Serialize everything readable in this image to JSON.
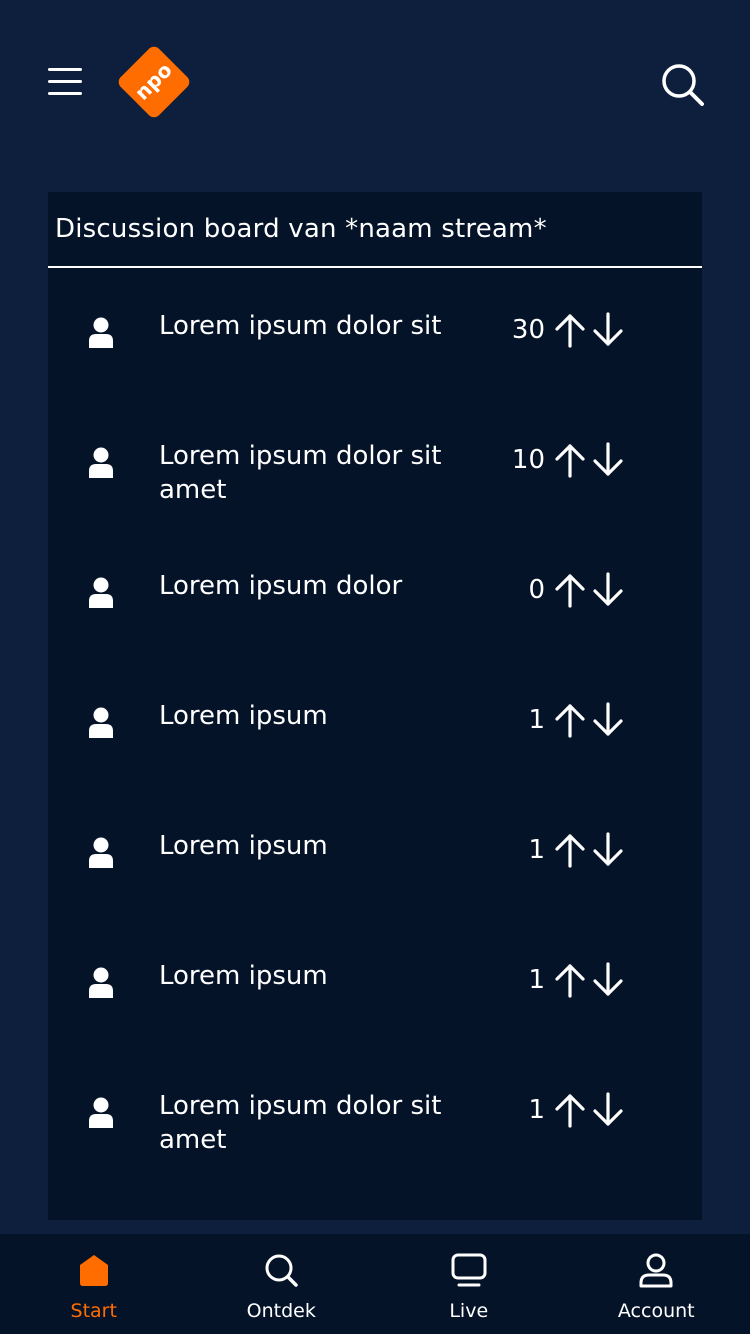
{
  "header": {
    "logo_text": "npo",
    "menu_icon": "hamburger-icon",
    "search_icon": "search-icon"
  },
  "board": {
    "title": "Discussion board van *naam stream*",
    "items": [
      {
        "text": "Lorem ipsum dolor sit",
        "score": "30"
      },
      {
        "text": "Lorem ipsum dolor sit amet",
        "score": "10"
      },
      {
        "text": "Lorem ipsum dolor",
        "score": "0"
      },
      {
        "text": "Lorem ipsum",
        "score": "1"
      },
      {
        "text": "Lorem ipsum",
        "score": "1"
      },
      {
        "text": "Lorem ipsum",
        "score": "1"
      },
      {
        "text": "Lorem ipsum dolor sit amet",
        "score": "1"
      }
    ]
  },
  "tabs": [
    {
      "label": "Start",
      "icon": "home-icon",
      "active": true
    },
    {
      "label": "Ontdek",
      "icon": "search-icon",
      "active": false
    },
    {
      "label": "Live",
      "icon": "tv-icon",
      "active": false
    },
    {
      "label": "Account",
      "icon": "user-icon",
      "active": false
    }
  ],
  "colors": {
    "background": "#0d1f3c",
    "panel": "#051329",
    "accent": "#ff6d00",
    "text": "#ffffff"
  }
}
